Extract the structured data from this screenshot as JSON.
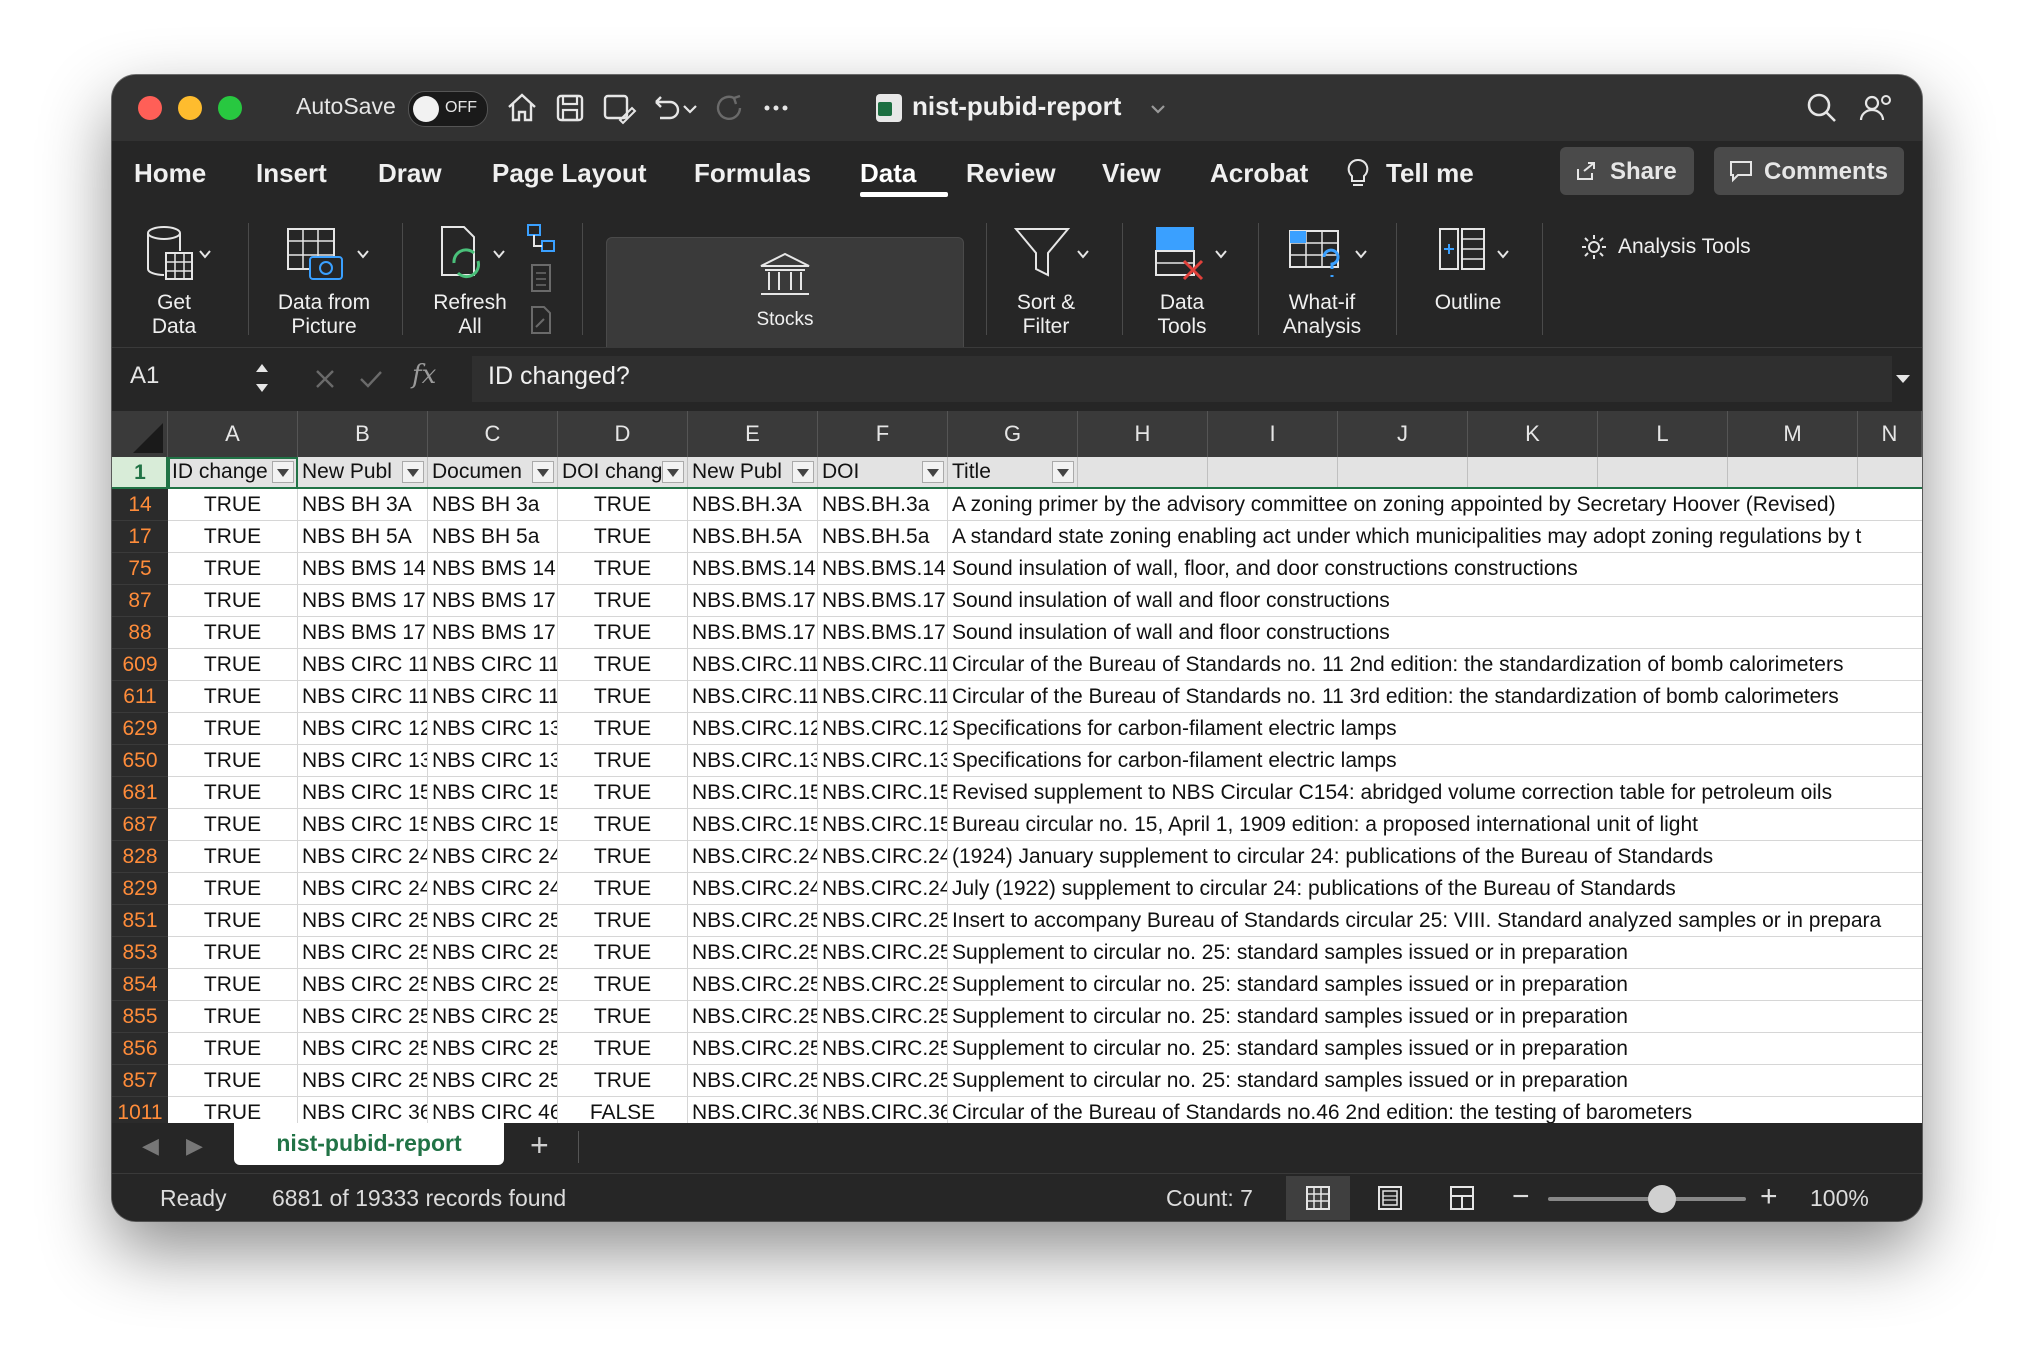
{
  "titlebar": {
    "autosave_label": "AutoSave",
    "autosave_state": "OFF",
    "document_title": "nist-pubid-report"
  },
  "ribbon_tabs": [
    "Home",
    "Insert",
    "Draw",
    "Page Layout",
    "Formulas",
    "Data",
    "Review",
    "View",
    "Acrobat",
    "Tell me"
  ],
  "active_tab": "Data",
  "share_label": "Share",
  "comments_label": "Comments",
  "ribbon": {
    "get_data": [
      "Get",
      "Data"
    ],
    "data_from_picture": [
      "Data from",
      "Picture"
    ],
    "refresh_all": [
      "Refresh",
      "All"
    ],
    "stocks": "Stocks",
    "sort_filter": [
      "Sort &",
      "Filter"
    ],
    "data_tools": [
      "Data",
      "Tools"
    ],
    "what_if": [
      "What-if",
      "Analysis"
    ],
    "outline": "Outline",
    "analysis_tools": "Analysis Tools"
  },
  "formula_bar": {
    "name_box": "A1",
    "fx": "fx",
    "content": "ID changed?"
  },
  "columns": [
    "A",
    "B",
    "C",
    "D",
    "E",
    "F",
    "G",
    "H",
    "I",
    "J",
    "K",
    "L",
    "M",
    "N"
  ],
  "header_row": {
    "row_number": "1",
    "cells": [
      "ID change",
      "New Publ",
      "Documen",
      "DOI chang",
      "New Publ",
      "DOI",
      "Title"
    ]
  },
  "rows": [
    {
      "n": "14",
      "a": "TRUE",
      "b": "NBS BH 3A",
      "c": "NBS BH 3a",
      "d": "TRUE",
      "e": "NBS.BH.3A",
      "f": "NBS.BH.3a",
      "g": "A zoning primer by the advisory committee on zoning appointed by Secretary Hoover (Revised)"
    },
    {
      "n": "17",
      "a": "TRUE",
      "b": "NBS BH 5A",
      "c": "NBS BH 5a",
      "d": "TRUE",
      "e": "NBS.BH.5A",
      "f": "NBS.BH.5a",
      "g": "A standard state zoning enabling act under which municipalities may adopt zoning regulations by t"
    },
    {
      "n": "75",
      "a": "TRUE",
      "b": "NBS BMS 14",
      "c": "NBS BMS 14",
      "d": "TRUE",
      "e": "NBS.BMS.14",
      "f": "NBS.BMS.14",
      "g": "Sound insulation of wall, floor, and door constructions constructions"
    },
    {
      "n": "87",
      "a": "TRUE",
      "b": "NBS BMS 17",
      "c": "NBS BMS 17",
      "d": "TRUE",
      "e": "NBS.BMS.17",
      "f": "NBS.BMS.17",
      "g": "Sound insulation of wall and floor constructions"
    },
    {
      "n": "88",
      "a": "TRUE",
      "b": "NBS BMS 17",
      "c": "NBS BMS 17",
      "d": "TRUE",
      "e": "NBS.BMS.17",
      "f": "NBS.BMS.17",
      "g": "Sound insulation of wall and floor constructions"
    },
    {
      "n": "609",
      "a": "TRUE",
      "b": "NBS CIRC 11",
      "c": "NBS CIRC 11",
      "d": "TRUE",
      "e": "NBS.CIRC.11",
      "f": "NBS.CIRC.11",
      "g": "Circular of the Bureau of Standards no. 11 2nd edition: the standardization of bomb calorimeters"
    },
    {
      "n": "611",
      "a": "TRUE",
      "b": "NBS CIRC 11",
      "c": "NBS CIRC 11",
      "d": "TRUE",
      "e": "NBS.CIRC.11",
      "f": "NBS.CIRC.11",
      "g": "Circular of the Bureau of Standards no. 11 3rd edition: the standardization of bomb calorimeters"
    },
    {
      "n": "629",
      "a": "TRUE",
      "b": "NBS CIRC 12",
      "c": "NBS CIRC 13",
      "d": "TRUE",
      "e": "NBS.CIRC.12",
      "f": "NBS.CIRC.12",
      "g": "Specifications for carbon-filament electric lamps"
    },
    {
      "n": "650",
      "a": "TRUE",
      "b": "NBS CIRC 13",
      "c": "NBS CIRC 13",
      "d": "TRUE",
      "e": "NBS.CIRC.13",
      "f": "NBS.CIRC.13",
      "g": "Specifications for carbon-filament electric lamps"
    },
    {
      "n": "681",
      "a": "TRUE",
      "b": "NBS CIRC 15",
      "c": "NBS CIRC 15",
      "d": "TRUE",
      "e": "NBS.CIRC.15",
      "f": "NBS.CIRC.15",
      "g": "Revised supplement to NBS Circular C154: abridged volume correction table for petroleum oils"
    },
    {
      "n": "687",
      "a": "TRUE",
      "b": "NBS CIRC 15",
      "c": "NBS CIRC 15",
      "d": "TRUE",
      "e": "NBS.CIRC.15",
      "f": "NBS.CIRC.15",
      "g": "Bureau circular no. 15, April 1, 1909 edition: a proposed international unit of light"
    },
    {
      "n": "828",
      "a": "TRUE",
      "b": "NBS CIRC 24",
      "c": "NBS CIRC 24",
      "d": "TRUE",
      "e": "NBS.CIRC.24",
      "f": "NBS.CIRC.24",
      "g": "(1924) January supplement to circular 24: publications of the Bureau of Standards"
    },
    {
      "n": "829",
      "a": "TRUE",
      "b": "NBS CIRC 24",
      "c": "NBS CIRC 24",
      "d": "TRUE",
      "e": "NBS.CIRC.24",
      "f": "NBS.CIRC.24",
      "g": "July (1922) supplement to circular 24: publications of the Bureau of Standards"
    },
    {
      "n": "851",
      "a": "TRUE",
      "b": "NBS CIRC 25",
      "c": "NBS CIRC 25",
      "d": "TRUE",
      "e": "NBS.CIRC.25",
      "f": "NBS.CIRC.25",
      "g": "Insert to accompany Bureau of Standards circular 25: VIII. Standard analyzed samples or in prepara"
    },
    {
      "n": "853",
      "a": "TRUE",
      "b": "NBS CIRC 25",
      "c": "NBS CIRC 25",
      "d": "TRUE",
      "e": "NBS.CIRC.25",
      "f": "NBS.CIRC.25",
      "g": "Supplement to circular no. 25: standard samples issued or in preparation"
    },
    {
      "n": "854",
      "a": "TRUE",
      "b": "NBS CIRC 25",
      "c": "NBS CIRC 25",
      "d": "TRUE",
      "e": "NBS.CIRC.25",
      "f": "NBS.CIRC.25",
      "g": "Supplement to circular no. 25: standard samples issued or in preparation"
    },
    {
      "n": "855",
      "a": "TRUE",
      "b": "NBS CIRC 25",
      "c": "NBS CIRC 25",
      "d": "TRUE",
      "e": "NBS.CIRC.25",
      "f": "NBS.CIRC.25",
      "g": "Supplement to circular no. 25: standard samples issued or in preparation"
    },
    {
      "n": "856",
      "a": "TRUE",
      "b": "NBS CIRC 25",
      "c": "NBS CIRC 25",
      "d": "TRUE",
      "e": "NBS.CIRC.25",
      "f": "NBS.CIRC.25",
      "g": "Supplement to circular no. 25: standard samples issued or in preparation"
    },
    {
      "n": "857",
      "a": "TRUE",
      "b": "NBS CIRC 25",
      "c": "NBS CIRC 25",
      "d": "TRUE",
      "e": "NBS.CIRC.25",
      "f": "NBS.CIRC.25",
      "g": "Supplement to circular no. 25: standard samples issued or in preparation"
    },
    {
      "n": "1011",
      "a": "TRUE",
      "b": "NBS CIRC 36",
      "c": "NBS CIRC 46",
      "d": "FALSE",
      "e": "NBS.CIRC.36",
      "f": "NBS.CIRC.36",
      "g": "Circular of the Bureau of Standards no.46 2nd edition: the testing of barometers"
    }
  ],
  "sheet_tab": "nist-pubid-report",
  "status": {
    "ready": "Ready",
    "records": "6881 of 19333 records found",
    "count": "Count: 7",
    "zoom": "100%"
  },
  "zoom_level_percent": 100,
  "colors": {
    "excel_green": "#217346",
    "filtered_row_number": "#ff8c3a",
    "chrome_dark": "#262626"
  }
}
